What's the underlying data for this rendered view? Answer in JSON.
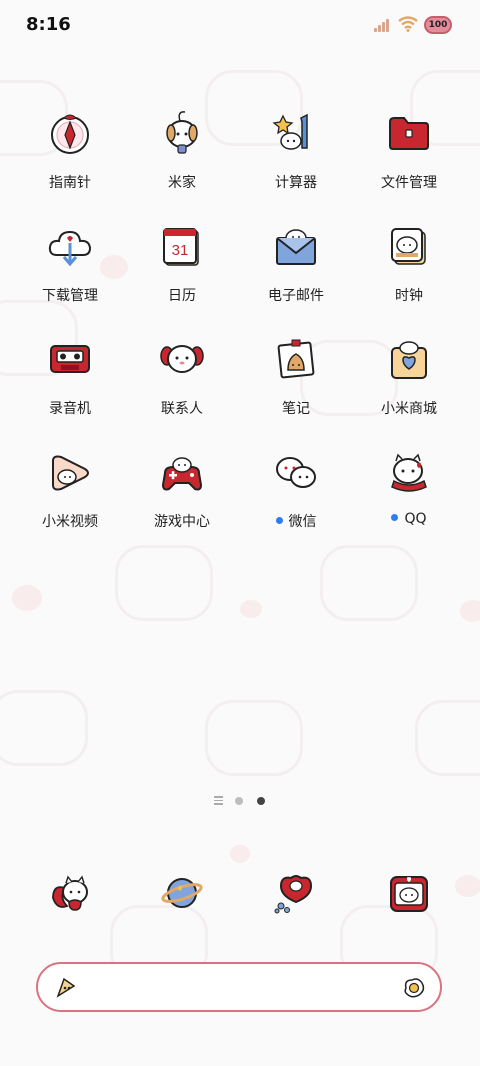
{
  "status": {
    "time": "8:16",
    "battery": "100"
  },
  "apps": [
    {
      "label": "指南针",
      "icon": "compass-icon"
    },
    {
      "label": "米家",
      "icon": "mijia-icon"
    },
    {
      "label": "计算器",
      "icon": "calculator-icon"
    },
    {
      "label": "文件管理",
      "icon": "folder-icon"
    },
    {
      "label": "下载管理",
      "icon": "download-cloud-icon"
    },
    {
      "label": "日历",
      "icon": "calendar-icon",
      "badge": "31"
    },
    {
      "label": "电子邮件",
      "icon": "mail-icon"
    },
    {
      "label": "时钟",
      "icon": "clock-icon"
    },
    {
      "label": "录音机",
      "icon": "recorder-icon"
    },
    {
      "label": "联系人",
      "icon": "contacts-icon"
    },
    {
      "label": "笔记",
      "icon": "notes-icon"
    },
    {
      "label": "小米商城",
      "icon": "shop-icon"
    },
    {
      "label": "小米视频",
      "icon": "video-icon"
    },
    {
      "label": "游戏中心",
      "icon": "gamepad-icon"
    },
    {
      "label": "微信",
      "icon": "wechat-icon",
      "new": true
    },
    {
      "label": "QQ",
      "icon": "qq-icon",
      "new": true
    }
  ],
  "pager": {
    "total_pages": 2,
    "current_page": 2
  },
  "dock": [
    {
      "icon": "phone-cat-icon"
    },
    {
      "icon": "browser-planet-icon"
    },
    {
      "icon": "messages-heart-icon"
    },
    {
      "icon": "camera-cat-icon"
    }
  ],
  "colors": {
    "accent": "#c8272f",
    "new_dot": "#2d7cf2",
    "search_border": "#d9737f"
  }
}
